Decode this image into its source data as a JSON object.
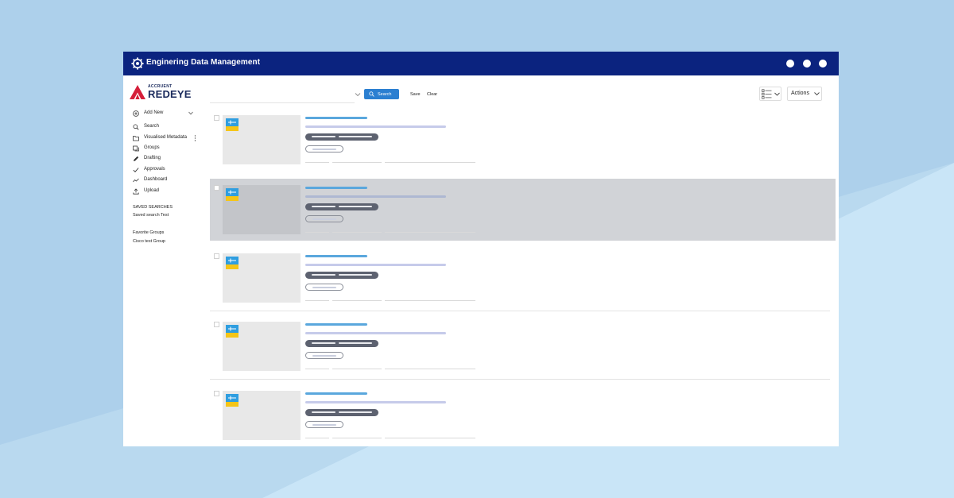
{
  "window": {
    "title": "Enginering Data Management"
  },
  "brand": {
    "company": "ACCRUENT",
    "product": "REDEYE"
  },
  "sidebar": {
    "add_new": "Add New",
    "items": [
      {
        "label": "Search",
        "icon": "search-icon"
      },
      {
        "label": "Visualised Metadata",
        "icon": "folder-icon"
      },
      {
        "label": "Groups",
        "icon": "groups-icon"
      },
      {
        "label": "Drafting",
        "icon": "pencil-icon"
      },
      {
        "label": "Approvals",
        "icon": "check-icon"
      },
      {
        "label": "Dashboard",
        "icon": "chart-line-icon"
      },
      {
        "label": "Upload",
        "icon": "upload-icon"
      }
    ],
    "saved_searches_heading": "SAVED SEARCHES",
    "saved_searches": [
      "Saved search Test"
    ],
    "favorite_groups_heading": "Favorite Groups",
    "favorite_groups": [
      "Cisco test Group"
    ]
  },
  "toolbar": {
    "search_label": "Search",
    "save_label": "Save",
    "clear_label": "Clear",
    "actions_label": "Actions"
  },
  "results": {
    "count": 5,
    "selected_index": 1
  },
  "colors": {
    "titlebar": "#0b237f",
    "accent": "#2b7fd1",
    "brand_red": "#d51f3a",
    "selected_row": "#d1d3d7",
    "background": "#b3d4ec"
  }
}
